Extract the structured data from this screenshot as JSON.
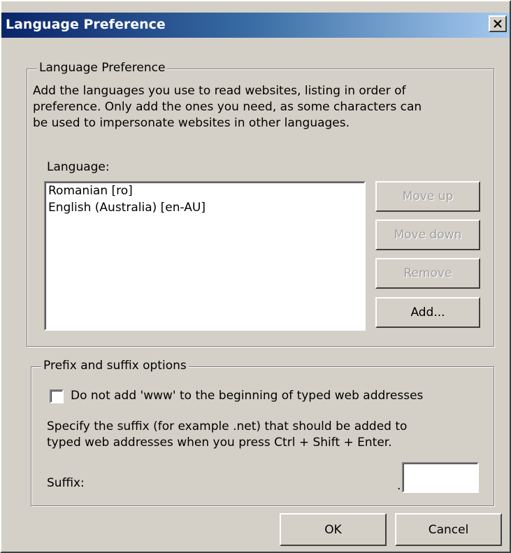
{
  "window": {
    "title": "Language Preference"
  },
  "language_group": {
    "legend": "Language Preference",
    "description_lines": [
      "Add the languages you use to read websites, listing in order of",
      "preference. Only add the ones you need, as some characters can",
      "be used to impersonate websites in other languages."
    ],
    "list_label": "Language:",
    "languages": [
      "Romanian [ro]",
      "English (Australia) [en-AU]"
    ],
    "buttons": {
      "move_up": "Move up",
      "move_down": "Move down",
      "remove": "Remove",
      "add": "Add..."
    }
  },
  "suffix_group": {
    "legend": "Prefix and suffix options",
    "checkbox_label": "Do not add 'www' to the beginning of typed web addresses",
    "checkbox_checked": false,
    "description_lines": [
      "Specify the suffix (for example .net) that should be added to",
      "typed web addresses when you press Ctrl + Shift + Enter."
    ],
    "suffix_label": "Suffix:",
    "suffix_dot": ".",
    "suffix_value": ""
  },
  "footer": {
    "ok_label": "OK",
    "cancel_label": "Cancel"
  },
  "colors": {
    "window_face": "#d4d0c8",
    "title_gradient_start": "#0a246a",
    "title_gradient_end": "#a6caf0",
    "disabled_text": "#a0a0a0"
  }
}
